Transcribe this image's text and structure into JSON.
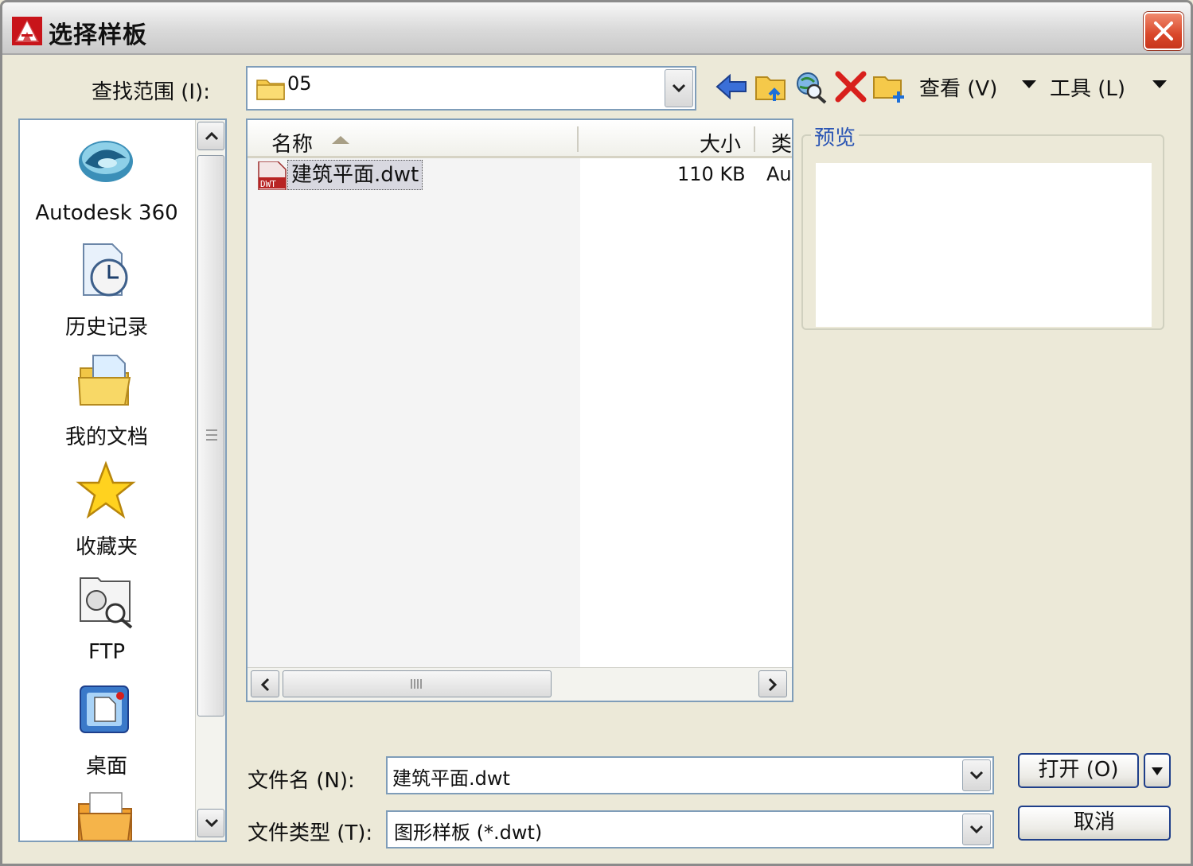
{
  "window": {
    "title": "选择样板"
  },
  "toolbar": {
    "lookin_label": "查找范围 (I):",
    "lookin_value": "05",
    "view_label": "查看 (V)",
    "tools_label": "工具 (L)"
  },
  "places": [
    {
      "label": "Autodesk 360",
      "icon": "cloud-icon"
    },
    {
      "label": "历史记录",
      "icon": "history-icon"
    },
    {
      "label": "我的文档",
      "icon": "my-documents-icon"
    },
    {
      "label": "收藏夹",
      "icon": "favorites-star-icon"
    },
    {
      "label": "FTP",
      "icon": "ftp-icon"
    },
    {
      "label": "桌面",
      "icon": "desktop-icon"
    }
  ],
  "filelist": {
    "columns": {
      "name": "名称",
      "size": "大小",
      "type": "类"
    },
    "rows": [
      {
        "name": "建筑平面.dwt",
        "size": "110 KB",
        "type": "Au"
      }
    ]
  },
  "preview": {
    "label": "预览"
  },
  "filename": {
    "label": "文件名 (N):",
    "value": "建筑平面.dwt"
  },
  "filetype": {
    "label": "文件类型 (T):",
    "value": "图形样板 (*.dwt)"
  },
  "buttons": {
    "open": "打开 (O)",
    "cancel": "取消"
  },
  "colors": {
    "accent_blue": "#2a55b4",
    "close_red": "#d9472a",
    "border": "#7f9db9"
  }
}
